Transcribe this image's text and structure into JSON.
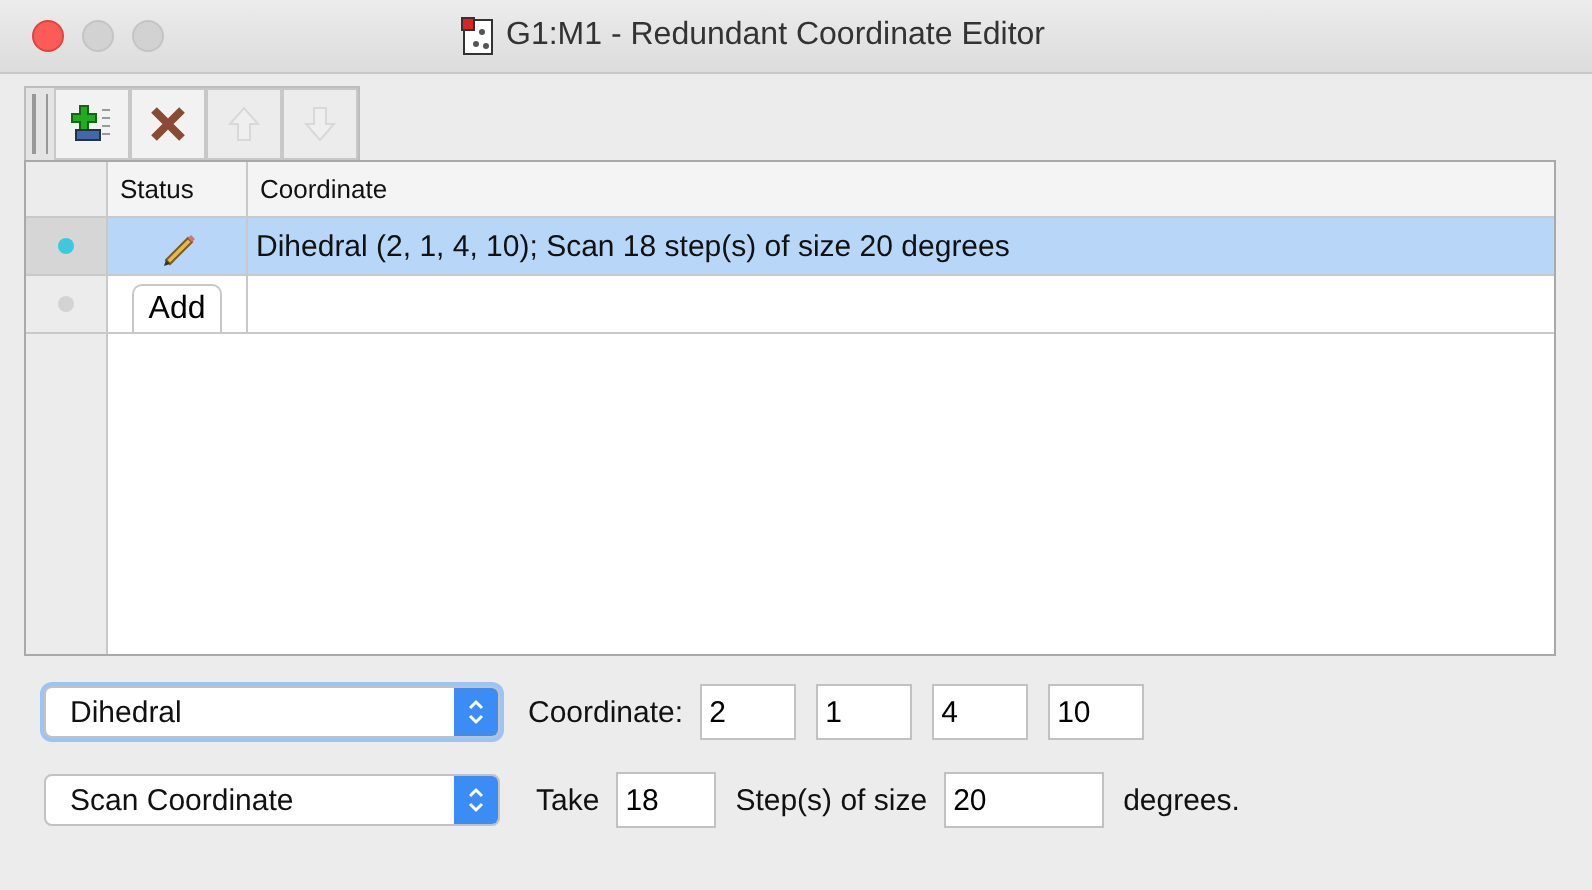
{
  "window": {
    "title": "G1:M1 - Redundant Coordinate Editor"
  },
  "toolbar": [
    {
      "kind": "add",
      "disabled": false
    },
    {
      "kind": "delete",
      "disabled": false
    },
    {
      "kind": "up",
      "disabled": true
    },
    {
      "kind": "down",
      "disabled": true
    }
  ],
  "table": {
    "columns": [
      "Status",
      "Coordinate"
    ],
    "rows": [
      {
        "selected": true,
        "status": {
          "kind": "pencil"
        },
        "coordinate": "Dihedral (2, 1, 4, 10); Scan 18 step(s) of size 20 degrees"
      },
      {
        "selected": false,
        "status": {
          "kind": "button",
          "label": "Add"
        },
        "coordinate": ""
      }
    ]
  },
  "coordinate_type": {
    "value": "Dihedral",
    "focused": true
  },
  "coordinate_label": "Coordinate:",
  "atoms": [
    "2",
    "1",
    "4",
    "10"
  ],
  "scan_type": {
    "value": "Scan Coordinate",
    "focused": false
  },
  "take_label": "Take",
  "steps": "18",
  "steps_label": "Step(s) of size",
  "size": "20",
  "units_label": "degrees."
}
